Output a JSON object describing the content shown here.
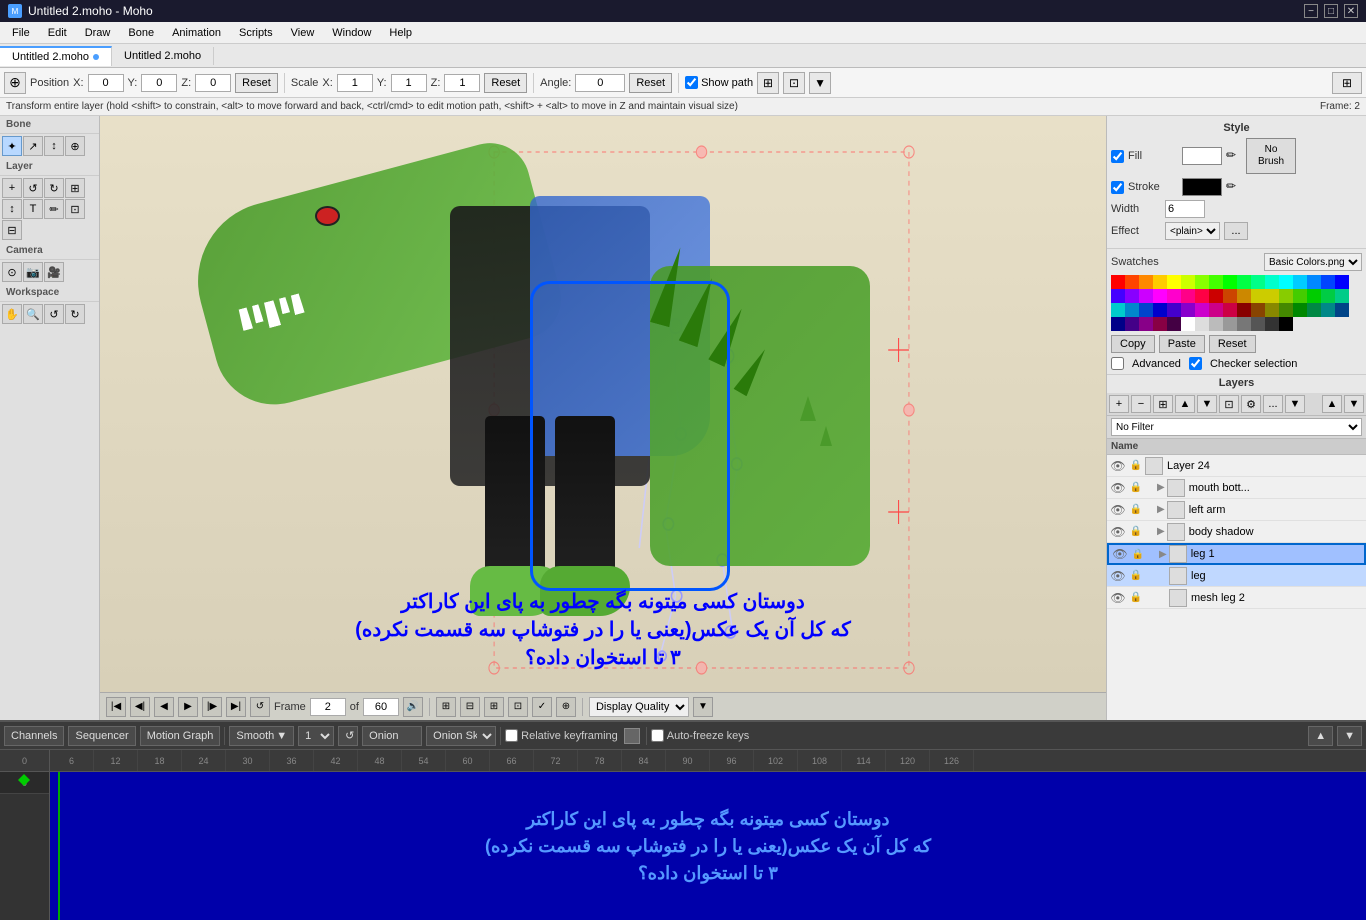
{
  "app": {
    "title": "Untitled 2.moho - Moho",
    "icon": "M"
  },
  "titlebar": {
    "title": "Untitled 2.moho - Moho",
    "minimize_label": "−",
    "maximize_label": "□",
    "close_label": "✕"
  },
  "menubar": {
    "items": [
      "File",
      "Edit",
      "Draw",
      "Bone",
      "Animation",
      "Scripts",
      "View",
      "Window",
      "Help"
    ]
  },
  "tabs": [
    {
      "label": "Untitled 2.moho",
      "active": true,
      "modified": true
    },
    {
      "label": "Untitled 2.moho",
      "active": false,
      "modified": false
    }
  ],
  "toolbar": {
    "position_label": "Position",
    "x_label": "X:",
    "x_value": "0",
    "y_label": "Y:",
    "y_value": "0",
    "z_label": "Z:",
    "z_value": "0",
    "reset_label": "Reset",
    "scale_label": "Scale",
    "sx_label": "X:",
    "sx_value": "1",
    "sy_label": "Y:",
    "sy_value": "1",
    "sz_label": "Z:",
    "sz_value": "1",
    "reset2_label": "Reset",
    "angle_label": "Angle:",
    "angle_value": "0",
    "reset3_label": "Reset",
    "show_path_label": "Show path"
  },
  "statusbar": {
    "text": "Transform entire layer (hold <shift> to constrain, <alt> to move forward and back, <ctrl/cmd> to edit motion path, <shift> + <alt> to move in Z and maintain visual size)",
    "frame_label": "Frame: 2"
  },
  "tools": {
    "bone_section": "Bone",
    "layer_section": "Layer",
    "camera_section": "Camera",
    "workspace_section": "Workspace",
    "bone_tools": [
      "✦",
      "↗",
      "↕",
      "⊕"
    ],
    "layer_tools": [
      "+",
      "↺",
      "↻",
      "⊞",
      "↕",
      "T",
      "✏",
      "⊡",
      "⊟"
    ],
    "camera_tools": [
      "⊙",
      "📷",
      "🎥"
    ],
    "workspace_tools": [
      "✋",
      "🔍",
      "↺",
      "↻"
    ]
  },
  "canvas": {
    "frame_number": "2"
  },
  "canvas_controls": {
    "play_btn": "▶",
    "frame_label": "Frame",
    "frame_value": "2",
    "of_label": "of",
    "total_frames": "60",
    "display_quality": "Display Quality"
  },
  "style_panel": {
    "title": "Style",
    "fill_label": "Fill",
    "stroke_label": "Stroke",
    "width_label": "Width",
    "width_value": "6",
    "effect_label": "Effect",
    "effect_value": "<plain>",
    "no_brush_label": "No Brush",
    "fill_checkbox": true,
    "stroke_checkbox": true
  },
  "swatches": {
    "title": "Swatches",
    "preset_label": "Basic Colors.png",
    "copy_label": "Copy",
    "paste_label": "Paste",
    "reset_label": "Reset",
    "advanced_label": "Advanced",
    "checker_label": "Checker selection",
    "colors": [
      "#ff0000",
      "#ff4400",
      "#ff8800",
      "#ffcc00",
      "#ffff00",
      "#ccff00",
      "#88ff00",
      "#44ff00",
      "#00ff00",
      "#00ff44",
      "#00ff88",
      "#00ffcc",
      "#00ffff",
      "#00ccff",
      "#0088ff",
      "#0044ff",
      "#0000ff",
      "#4400ff",
      "#8800ff",
      "#cc00ff",
      "#ff00ff",
      "#ff00cc",
      "#ff0088",
      "#ff0044",
      "#cc0000",
      "#cc4400",
      "#cc8800",
      "#cccc00",
      "#cccc00",
      "#88cc00",
      "#44cc00",
      "#00cc00",
      "#00cc44",
      "#00cc88",
      "#00cccc",
      "#0088cc",
      "#0044cc",
      "#0000cc",
      "#4400cc",
      "#8800cc",
      "#cc00cc",
      "#cc0088",
      "#cc0044",
      "#880000",
      "#884400",
      "#888800",
      "#448800",
      "#008800",
      "#008844",
      "#008888",
      "#004488",
      "#000088",
      "#440088",
      "#880088",
      "#880044",
      "#440044",
      "#ffffff",
      "#dddddd",
      "#bbbbbb",
      "#999999",
      "#777777",
      "#555555",
      "#333333",
      "#000000"
    ]
  },
  "layers_panel": {
    "title": "Layers",
    "filter_value": "No Filter",
    "name_col": "Name",
    "layers": [
      {
        "name": "Layer 24",
        "visible": true,
        "locked": false,
        "type": "layer",
        "indent": 0,
        "selected": false
      },
      {
        "name": "mouth bott...",
        "visible": true,
        "locked": false,
        "type": "group",
        "indent": 1,
        "selected": false
      },
      {
        "name": "left arm",
        "visible": true,
        "locked": false,
        "type": "group",
        "indent": 1,
        "selected": false
      },
      {
        "name": "body shadow",
        "visible": true,
        "locked": false,
        "type": "group",
        "indent": 1,
        "selected": false
      },
      {
        "name": "leg 1",
        "visible": true,
        "locked": false,
        "type": "group",
        "indent": 1,
        "selected": false,
        "highlighted": true
      },
      {
        "name": "leg",
        "visible": true,
        "locked": false,
        "type": "layer",
        "indent": 2,
        "selected": true
      },
      {
        "name": "mesh leg 2",
        "visible": true,
        "locked": false,
        "type": "layer",
        "indent": 2,
        "selected": false
      }
    ]
  },
  "timeline": {
    "smooth_label": "Smooth",
    "onion_label": "Onion",
    "onion_skins_label": "Onion Skins",
    "relative_keyframe_label": "Relative keyframing",
    "auto_freeze_label": "Auto-freeze keys",
    "frame_label": "Frame",
    "frame_value": "2",
    "of_label": "of",
    "total_frames": "60",
    "tabs": [
      "Channels",
      "Sequencer",
      "Motion Graph"
    ],
    "active_tab": "Channels",
    "multiplier_value": "1",
    "track_numbers": [
      "6",
      "12",
      "18",
      "24",
      "30",
      "36",
      "42",
      "48",
      "54",
      "60",
      "66",
      "72",
      "78",
      "84",
      "90",
      "96",
      "102",
      "108",
      "114",
      "120",
      "126"
    ]
  },
  "canvas_overlay": {
    "text_line1": "دوستان کسی میتونه بگه چطور به پای این کاراکتر",
    "text_line2": "که کل آن یک عکس(یعنی یا را در فتوشاپ سه قسمت نکرده)",
    "text_line3": "۳ تا استخوان داده؟"
  }
}
